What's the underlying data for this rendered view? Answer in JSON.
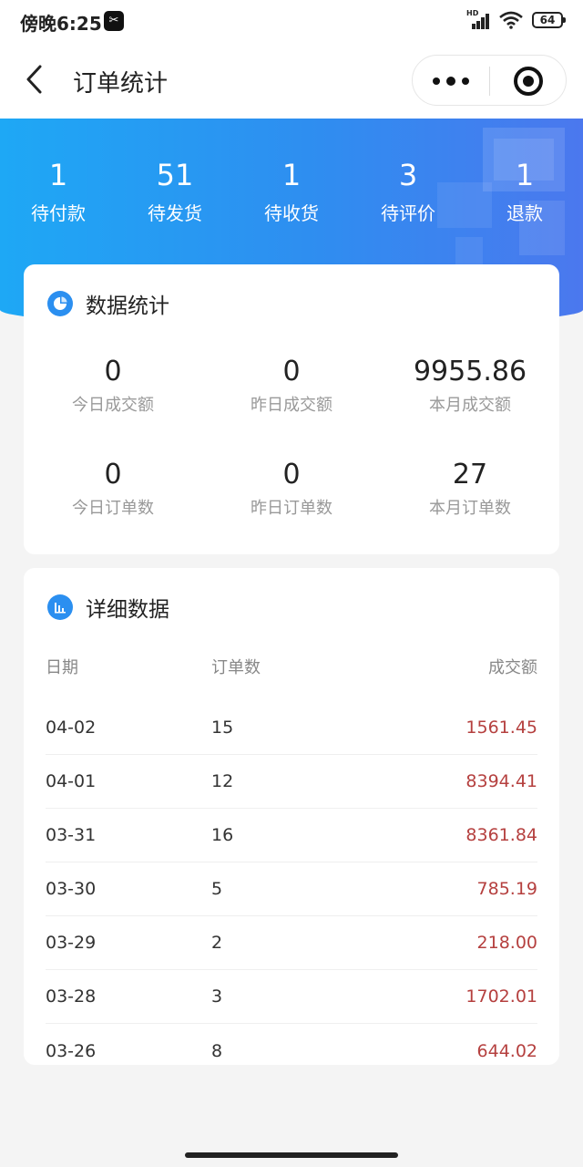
{
  "status_bar": {
    "time": "傍晚6:25",
    "network": "HD",
    "battery": "64"
  },
  "nav": {
    "title": "订单统计"
  },
  "order_status": [
    {
      "count": "1",
      "label": "待付款"
    },
    {
      "count": "51",
      "label": "待发货"
    },
    {
      "count": "1",
      "label": "待收货"
    },
    {
      "count": "3",
      "label": "待评价"
    },
    {
      "count": "1",
      "label": "退款"
    }
  ],
  "stats_card": {
    "title": "数据统计",
    "items": [
      {
        "value": "0",
        "label": "今日成交额"
      },
      {
        "value": "0",
        "label": "昨日成交额"
      },
      {
        "value": "9955.86",
        "label": "本月成交额"
      },
      {
        "value": "0",
        "label": "今日订单数"
      },
      {
        "value": "0",
        "label": "昨日订单数"
      },
      {
        "value": "27",
        "label": "本月订单数"
      }
    ]
  },
  "detail_card": {
    "title": "详细数据",
    "columns": {
      "date": "日期",
      "count": "订单数",
      "amount": "成交额"
    },
    "rows": [
      {
        "date": "04-02",
        "count": "15",
        "amount": "1561.45"
      },
      {
        "date": "04-01",
        "count": "12",
        "amount": "8394.41"
      },
      {
        "date": "03-31",
        "count": "16",
        "amount": "8361.84"
      },
      {
        "date": "03-30",
        "count": "5",
        "amount": "785.19"
      },
      {
        "date": "03-29",
        "count": "2",
        "amount": "218.00"
      },
      {
        "date": "03-28",
        "count": "3",
        "amount": "1702.01"
      },
      {
        "date": "03-26",
        "count": "8",
        "amount": "644.02"
      }
    ]
  },
  "colors": {
    "accent": "#2b8ff0",
    "amount": "#b5403f",
    "hero_start": "#1ea8f5",
    "hero_end": "#4b78ee"
  },
  "icons": [
    "back-chevron-icon",
    "more-dots-icon",
    "close-target-icon",
    "pie-chart-icon",
    "bar-chart-icon",
    "signal-icon",
    "wifi-icon",
    "battery-icon",
    "app-icon"
  ]
}
